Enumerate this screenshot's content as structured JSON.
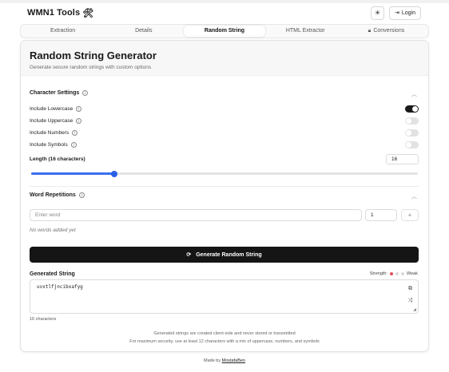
{
  "app": {
    "brand": "WMN1 Tools",
    "brand_icon": "tools-icon"
  },
  "header": {
    "theme_icon": "sun-icon",
    "login_label": "Login"
  },
  "tabs": [
    {
      "label": "Extraction",
      "active": false
    },
    {
      "label": "Details",
      "active": false
    },
    {
      "label": "Random String",
      "active": true
    },
    {
      "label": "HTML Extractor",
      "active": false
    },
    {
      "label": "Conversions",
      "active": false,
      "icon": "lock-icon"
    }
  ],
  "card": {
    "title": "Random String Generator",
    "subtitle": "Generate secure random strings with custom options"
  },
  "character_settings": {
    "title": "Character Settings",
    "options": [
      {
        "label": "Include Lowercase",
        "enabled": true
      },
      {
        "label": "Include Uppercase",
        "enabled": false
      },
      {
        "label": "Include Numbers",
        "enabled": false
      },
      {
        "label": "Include Symbols",
        "enabled": false
      }
    ],
    "length_label": "Length (16 characters)",
    "length_value": "16",
    "slider_fraction": 0.215
  },
  "word_repetitions": {
    "title": "Word Repetitions",
    "word_placeholder": "Enter word",
    "count_value": "1",
    "add_label": "+",
    "empty_text": "No words added yet"
  },
  "generate": {
    "button_label": "Generate Random String"
  },
  "output": {
    "label": "Generated String",
    "strength_label": "Strength:",
    "strength_value": "Weak",
    "value": "uvxtlfjncibxafyg",
    "char_count": "16 characters"
  },
  "notes": {
    "line1": "Generated strings are created client-side and never stored or transmitted",
    "line2": "For maximum security, use at least 12 characters with a mix of uppercase, numbers, and symbols"
  },
  "footer": {
    "prefix": "Made by",
    "author": "MostafaBen"
  },
  "colors": {
    "accent": "#2a5fe8",
    "button_dark": "#151515",
    "strength_weak": "#e84a5f"
  }
}
